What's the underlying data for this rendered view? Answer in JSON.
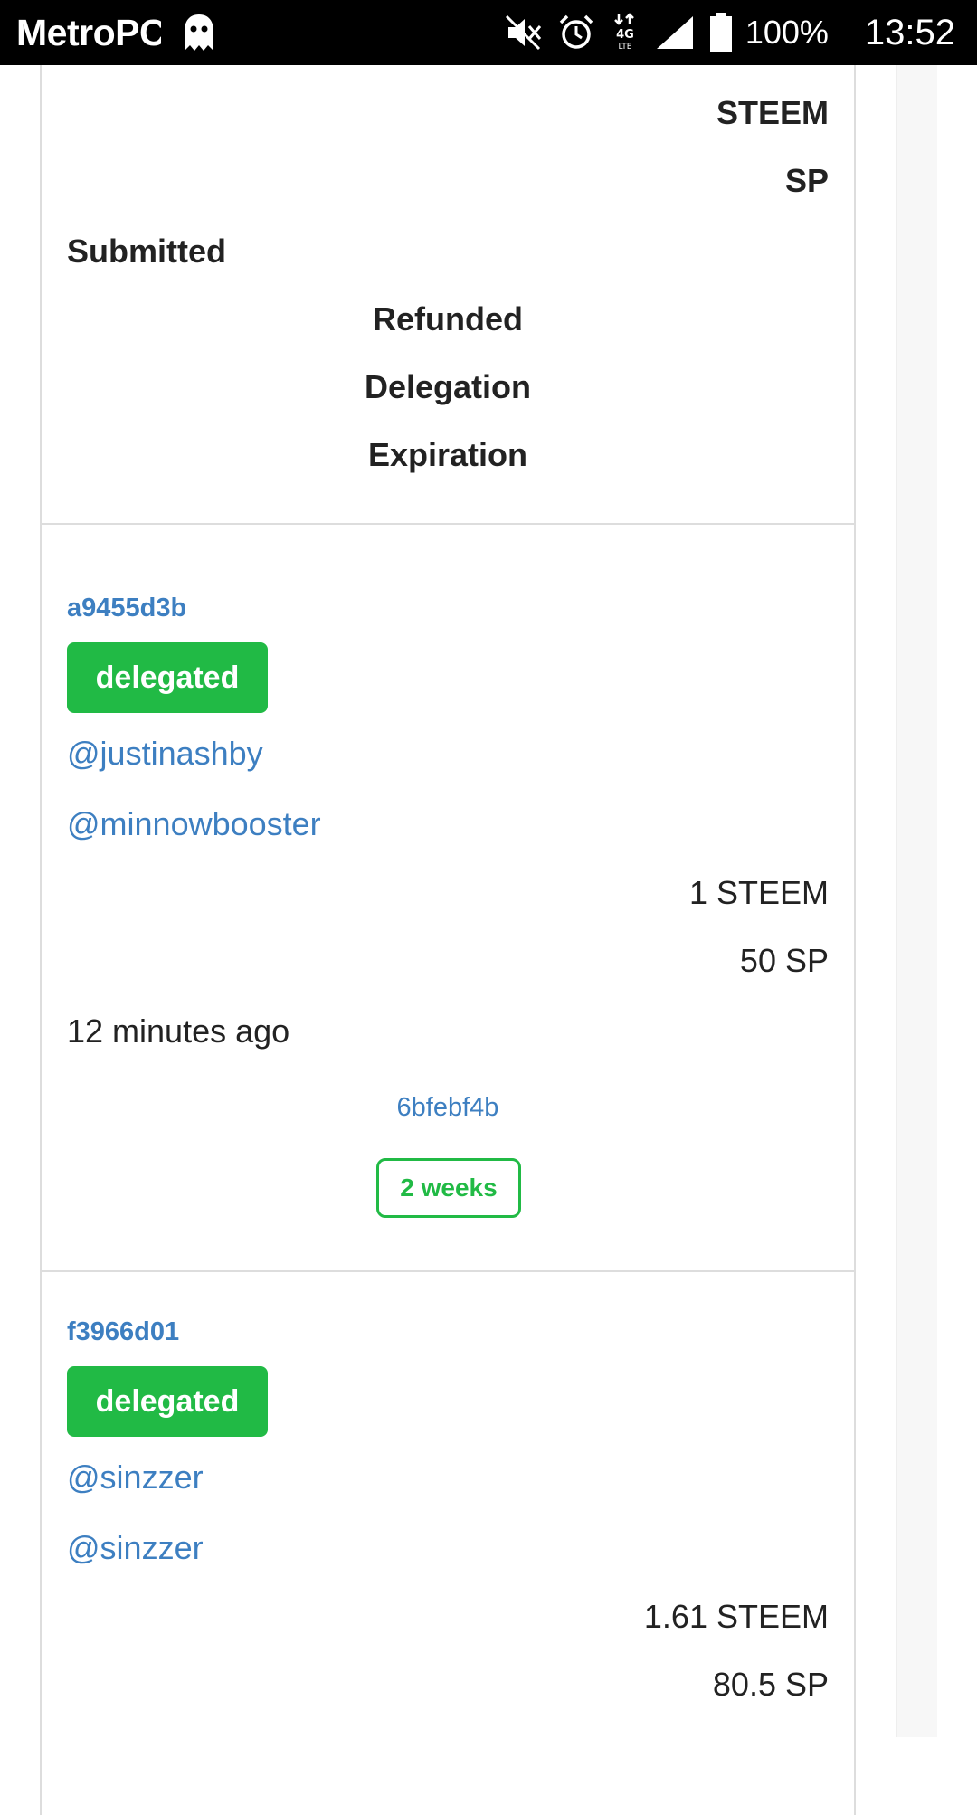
{
  "status_bar": {
    "carrier": "MetroPCS",
    "network": "4G LTE",
    "battery": "100%",
    "time": "13:52",
    "icons": [
      "ghost-icon",
      "mute-icon",
      "alarm-icon",
      "data-arrows-icon",
      "signal-icon",
      "battery-icon"
    ]
  },
  "table_header": {
    "steem": "STEEM",
    "sp": "SP",
    "submitted": "Submitted",
    "refunded": "Refunded",
    "delegation": "Delegation",
    "expiration": "Expiration"
  },
  "rows": [
    {
      "id": "a9455d3b",
      "status": "delegated",
      "from": "@justinashby",
      "to": "@minnowbooster",
      "steem": "1 STEEM",
      "sp": "50 SP",
      "submitted": "12 minutes ago",
      "delegation_tx": "6bfebf4b",
      "expiration": "2 weeks"
    },
    {
      "id": "f3966d01",
      "status": "delegated",
      "from": "@sinzzer",
      "to": "@sinzzer",
      "steem": "1.61 STEEM",
      "sp": "80.5 SP"
    }
  ],
  "colors": {
    "accent_green": "#21ba45",
    "link_blue": "#3d7fc1",
    "text": "#222222",
    "border": "#dddddd"
  }
}
